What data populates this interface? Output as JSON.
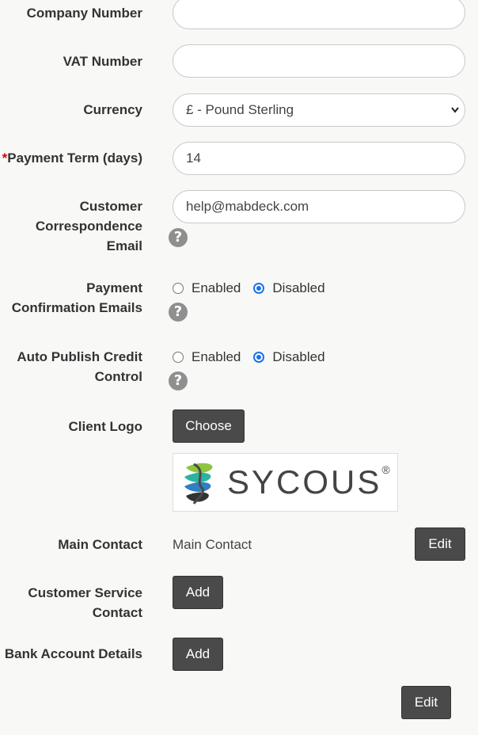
{
  "fields": {
    "company_number": {
      "label": "Company Number",
      "value": ""
    },
    "vat_number": {
      "label": "VAT Number",
      "value": ""
    },
    "currency": {
      "label": "Currency",
      "value": "£ - Pound Sterling"
    },
    "payment_term": {
      "required_mark": "*",
      "label": "Payment Term (days)",
      "value": "14"
    },
    "correspondence_email": {
      "label_line1": "Customer",
      "label_line2": "Correspondence",
      "label_line3": "Email",
      "value": "help@mabdeck.com"
    }
  },
  "payment_confirmation": {
    "label_line1": "Payment",
    "label_line2": "Confirmation Emails",
    "options": [
      "Enabled",
      "Disabled"
    ],
    "selected": "Disabled"
  },
  "auto_publish": {
    "label_line1": "Auto Publish Credit",
    "label_line2": "Control",
    "options": [
      "Enabled",
      "Disabled"
    ],
    "selected": "Disabled"
  },
  "client_logo": {
    "label": "Client Logo",
    "choose_label": "Choose",
    "logo_text": "SYCOUS",
    "logo_reg": "®"
  },
  "main_contact": {
    "label": "Main Contact",
    "value": "Main Contact",
    "edit_label": "Edit"
  },
  "customer_service_contact": {
    "label_line1": "Customer Service",
    "label_line2": "Contact",
    "add_label": "Add"
  },
  "bank_account": {
    "label": "Bank Account Details",
    "add_label": "Add"
  },
  "footer": {
    "edit_label": "Edit"
  },
  "help_glyph": "?",
  "icons": {
    "help": "question-circle-icon",
    "select_arrow": "chevron-down-icon"
  },
  "colors": {
    "button": "#4a4a4a",
    "radio_checked": "#1a73e8",
    "required": "#dd0000"
  }
}
